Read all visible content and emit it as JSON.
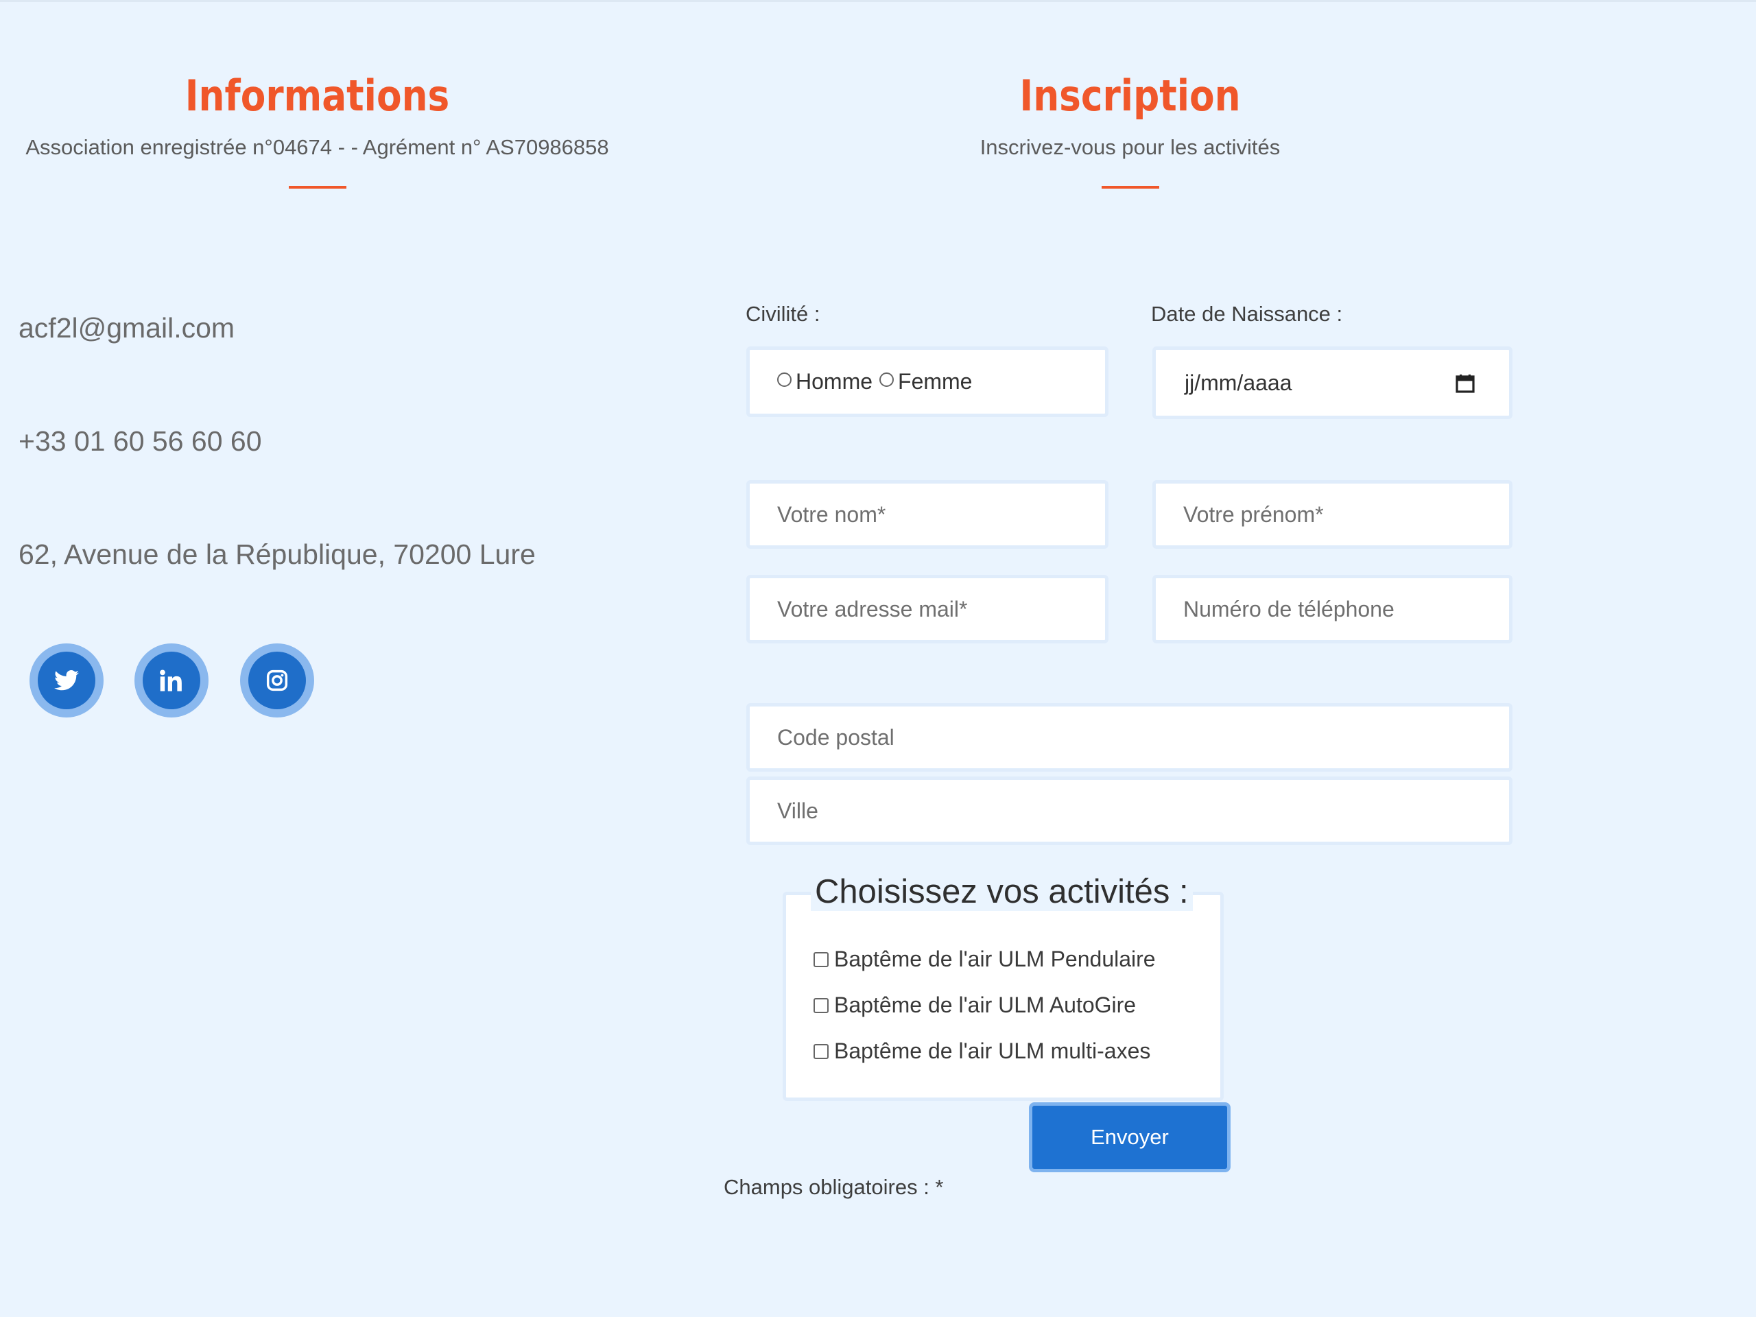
{
  "info": {
    "title": "Informations",
    "subtitle": "Association enregistrée n°04674 - - Agrément n° AS70986858",
    "email": "acf2l@gmail.com",
    "phone": "+33 01 60 56 60 60",
    "address": "62, Avenue de la République, 70200 Lure",
    "social": [
      "twitter-icon",
      "linkedin-icon",
      "instagram-icon"
    ]
  },
  "inscription": {
    "title": "Inscription",
    "subtitle": "Inscrivez-vous pour les activités"
  },
  "form": {
    "civilite_label": "Civilité :",
    "civilite_options": [
      "Homme",
      "Femme"
    ],
    "dob_label": "Date de Naissance :",
    "dob_placeholder": "jj/mm/aaaa",
    "nom_placeholder": "Votre nom*",
    "prenom_placeholder": "Votre prénom*",
    "mail_placeholder": "Votre adresse mail*",
    "tel_placeholder": "Numéro de téléphone",
    "cp_placeholder": "Code postal",
    "ville_placeholder": "Ville",
    "activities_legend": "Choisissez vos activités :",
    "activities": [
      "Baptême de l'air ULM Pendulaire",
      "Baptême de l'air ULM AutoGire",
      "Baptême de l'air ULM multi-axes"
    ],
    "submit_label": "Envoyer",
    "required_note": "Champs obligatoires : *"
  },
  "colors": {
    "background": "#eaf4fe",
    "accent": "#f0572a",
    "primary": "#1e72d2"
  }
}
